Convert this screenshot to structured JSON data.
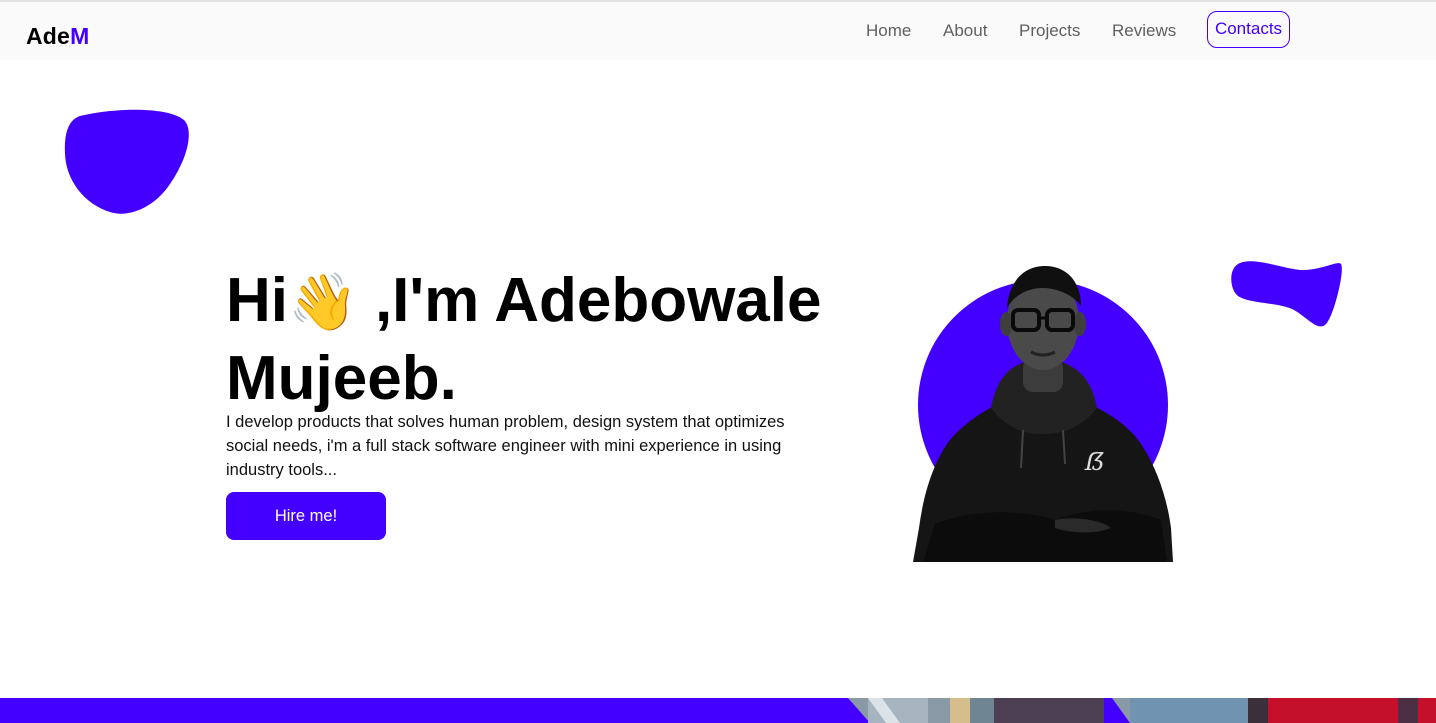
{
  "nav": {
    "logo_main": "Ade",
    "logo_accent": "M",
    "links": [
      "Home",
      "About",
      "Projects",
      "Reviews"
    ],
    "contact_label": "Contacts"
  },
  "hero": {
    "greeting": "Hi",
    "wave_emoji": "👋",
    "name_line": " ,I'm Adebowale Mujeeb.",
    "description": "I develop products that solves human problem, design system that optimizes social needs, i'm a full stack software engineer with mini experience in using industry tools...",
    "cta_label": "Hire me!"
  },
  "colors": {
    "accent": "#4400ff",
    "nav_background": "#fafafa",
    "text": "#000000",
    "nav_text": "#5f5f5f"
  },
  "icons": {
    "wave": "waving-hand-icon"
  }
}
